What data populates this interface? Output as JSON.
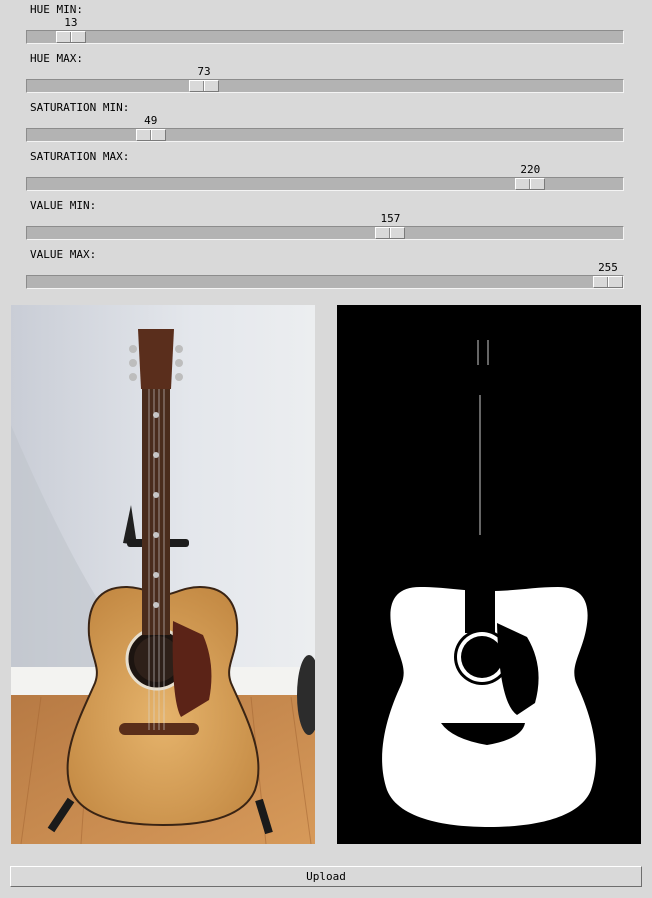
{
  "sliders": [
    {
      "label": "HUE MIN:",
      "value": 13,
      "min": 0,
      "max": 255
    },
    {
      "label": "HUE MAX:",
      "value": 73,
      "min": 0,
      "max": 255
    },
    {
      "label": "SATURATION MIN:",
      "value": 49,
      "min": 0,
      "max": 255
    },
    {
      "label": "SATURATION MAX:",
      "value": 220,
      "min": 0,
      "max": 255
    },
    {
      "label": "VALUE MIN:",
      "value": 157,
      "min": 0,
      "max": 255
    },
    {
      "label": "VALUE MAX:",
      "value": 255,
      "min": 0,
      "max": 255
    }
  ],
  "upload_button": {
    "label": "Upload"
  },
  "colors": {
    "background": "#d9d9d9",
    "trough": "#b3b3b3",
    "mask_background": "#000000",
    "mask_foreground": "#ffffff",
    "wall": "#dfe4ea",
    "floor_wood": "#c98a4c",
    "guitar_top": "#d9a560",
    "guitar_neck": "#4a2c1c"
  },
  "images": {
    "original": {
      "icon": "guitar-photo"
    },
    "mask": {
      "icon": "guitar-mask"
    }
  }
}
